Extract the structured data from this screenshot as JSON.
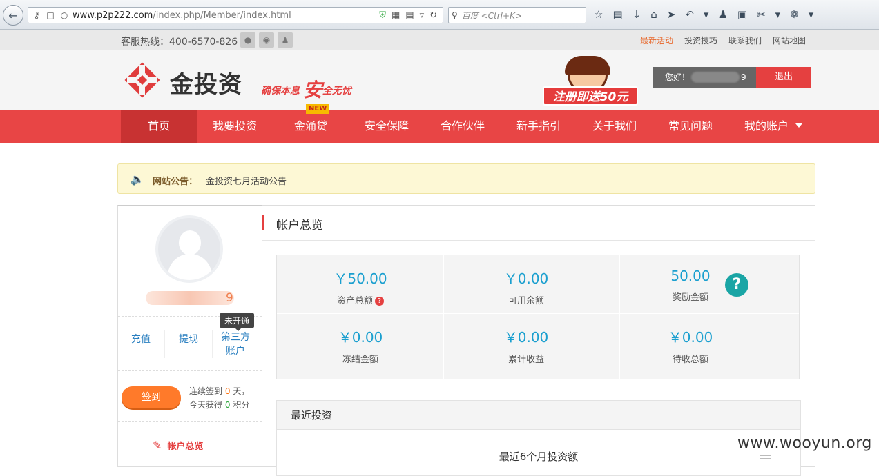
{
  "browser": {
    "url_host": "www.p2p222.com",
    "url_path": "/index.php/Member/index.html",
    "search_placeholder": "百度 <Ctrl+K>"
  },
  "topbar": {
    "hotline": "客服热线：400-6570-826",
    "links": [
      "最新活动",
      "投资技巧",
      "联系我们",
      "网站地图"
    ]
  },
  "header": {
    "logo_text": "金投资",
    "slogan_left": "确保本息",
    "slogan_big": "安",
    "slogan_right": "全无忧",
    "promo_text": "注册即送50元",
    "greeting": "您好！",
    "user_tail": "9",
    "logout": "退出"
  },
  "nav": {
    "items": [
      "首页",
      "我要投资",
      "金涌贷",
      "安全保障",
      "合作伙伴",
      "新手指引",
      "关于我们",
      "常见问题",
      "我的账户"
    ],
    "badge": "NEW"
  },
  "notice": {
    "label": "网站公告：",
    "message": "金投资七月活动公告"
  },
  "sidebar": {
    "username_tail": "9",
    "tooltip": "未开通",
    "actions": [
      "充值",
      "提现",
      "第三方",
      "账户"
    ],
    "checkin": "签到",
    "streak_line1_pre": "连续签到",
    "streak_days": "0",
    "streak_line1_post": "天，",
    "streak_line2_pre": "今天获得",
    "streak_points": "0",
    "streak_line2_post": "积分",
    "menu_item": "帐户总览"
  },
  "main": {
    "title": "帐户总览",
    "stats": [
      {
        "value": "￥50.00",
        "label": "资产总额"
      },
      {
        "value": "￥0.00",
        "label": "可用余额"
      },
      {
        "value": "50.00",
        "label": "奖励金额"
      },
      {
        "value": "￥0.00",
        "label": "冻结金额"
      },
      {
        "value": "￥0.00",
        "label": "累计收益"
      },
      {
        "value": "￥0.00",
        "label": "待收总额"
      }
    ],
    "help_symbol": "?",
    "asset_hint": "?",
    "recent_title": "最近投资",
    "recent_chart_title": "最近6个月投资额"
  },
  "watermark": "www.wooyun.org",
  "colors": {
    "brand_red": "#e84545",
    "accent_orange": "#ff7a2a",
    "value_blue": "#1a9fcf"
  }
}
